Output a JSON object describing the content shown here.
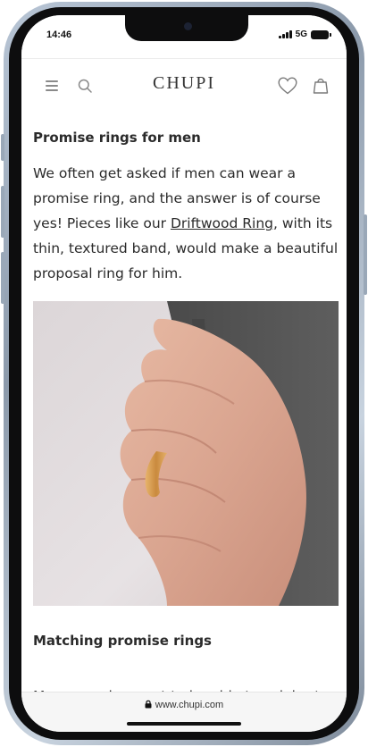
{
  "status_bar": {
    "time": "14:46",
    "network": "5G"
  },
  "header": {
    "logo": "CHUPI"
  },
  "article": {
    "section1": {
      "heading": "Promise rings for men",
      "text_before_link": "We often get asked if men can wear a promise ring, and the answer is of course yes! Pieces like our ",
      "link_text": "Driftwood Ring",
      "text_after_link": ", with its thin, textured band, would make a beautiful proposal ring for him."
    },
    "section2": {
      "heading": "Matching promise rings",
      "text": "Many couples want to be able to celebrate"
    }
  },
  "browser": {
    "url": "www.chupi.com"
  }
}
